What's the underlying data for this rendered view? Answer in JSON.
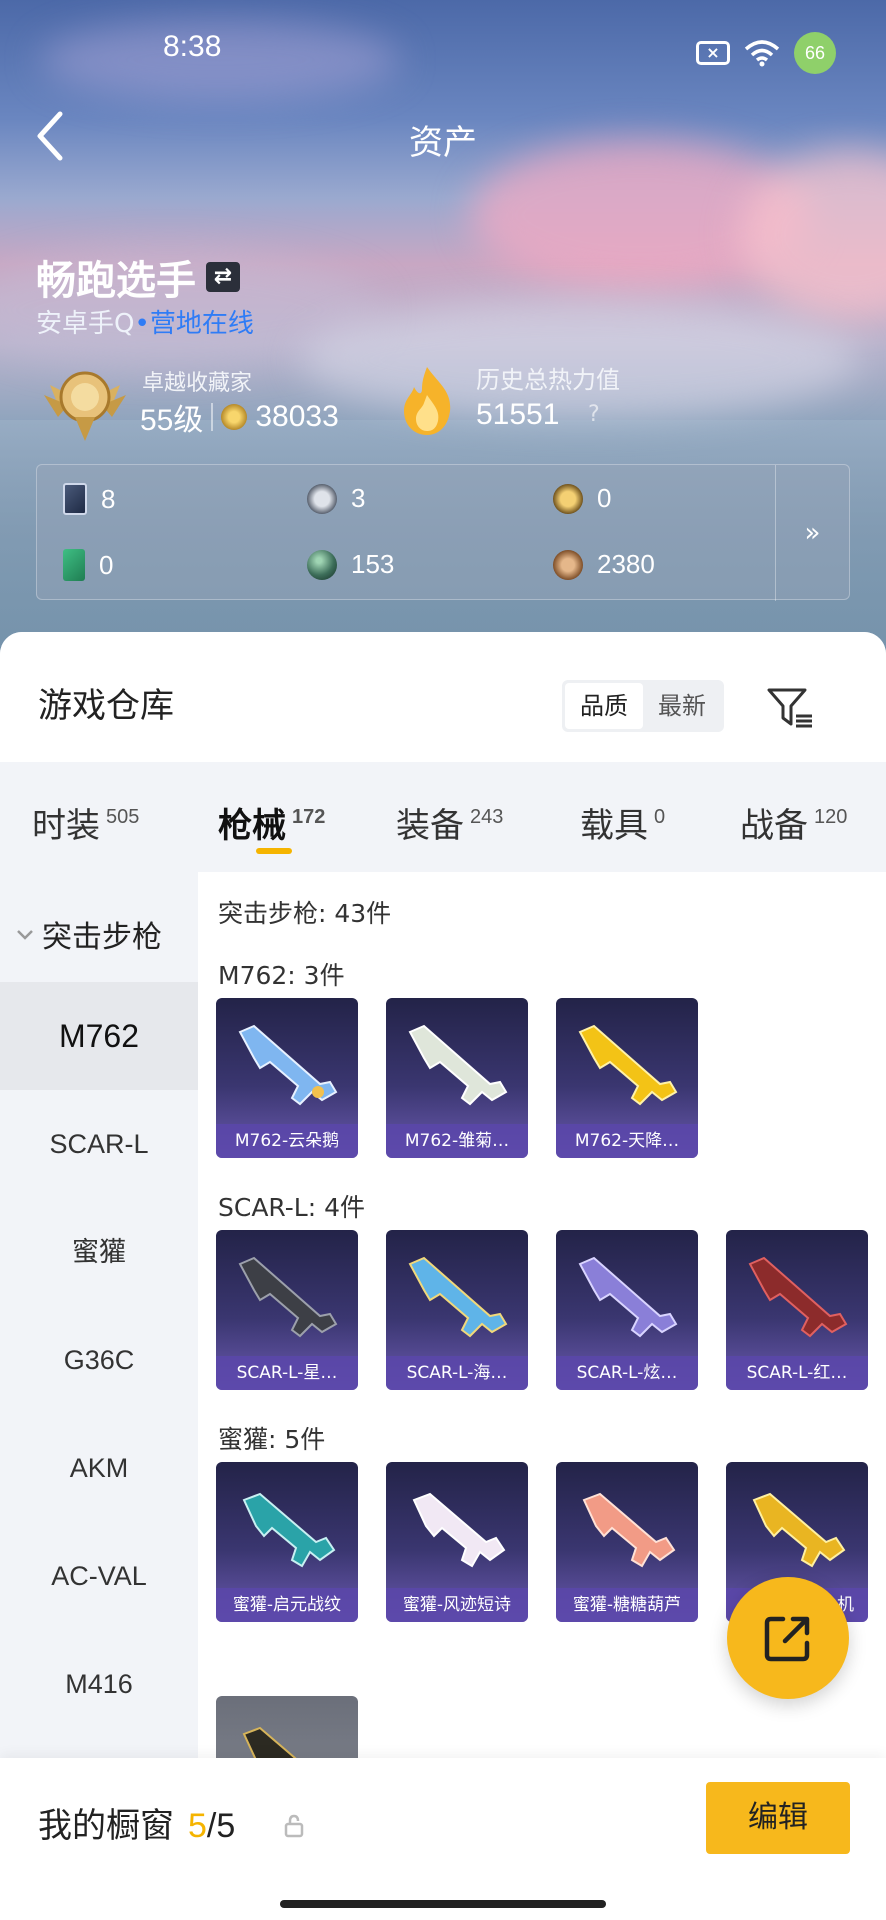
{
  "status": {
    "time": "8:38",
    "battery": "66"
  },
  "header": {
    "title": "资产"
  },
  "profile": {
    "name": "畅跑选手",
    "platform": "安卓手Q",
    "online": "营地在线",
    "rank_title": "卓越收藏家",
    "rank_level": "55级",
    "coins": "38033",
    "heat_title": "历史总热力值",
    "heat_value": "51551",
    "help": "?"
  },
  "stats": [
    {
      "icon": "card-icon",
      "value": "8"
    },
    {
      "icon": "s-coin-icon",
      "value": "3"
    },
    {
      "icon": "a-coin-icon",
      "value": "0"
    },
    {
      "icon": "ticket-icon",
      "value": "0"
    },
    {
      "icon": "orb-icon",
      "value": "153"
    },
    {
      "icon": "bronze-coin-icon",
      "value": "2380"
    }
  ],
  "stats_more": "»",
  "warehouse": {
    "title": "游戏仓库",
    "sort_options": [
      "品质",
      "最新"
    ],
    "sort_selected": "品质"
  },
  "tabs": [
    {
      "label": "时装",
      "count": "505"
    },
    {
      "label": "枪械",
      "count": "172"
    },
    {
      "label": "装备",
      "count": "243"
    },
    {
      "label": "载具",
      "count": "0"
    },
    {
      "label": "战备",
      "count": "120"
    }
  ],
  "sidebar": {
    "category": "突击步枪",
    "items": [
      "M762",
      "SCAR-L",
      "蜜獾",
      "G36C",
      "AKM",
      "AC-VAL",
      "M416"
    ]
  },
  "sections": {
    "total": "突击步枪: 43件",
    "m762": {
      "label": "M762: 3件",
      "items": [
        "M762-云朵鹅",
        "M762-雏菊…",
        "M762-天降…"
      ]
    },
    "scar": {
      "label": "SCAR-L: 4件",
      "items": [
        "SCAR-L-星…",
        "SCAR-L-海…",
        "SCAR-L-炫…",
        "SCAR-L-红…"
      ]
    },
    "honey": {
      "label": "蜜獾: 5件",
      "items": [
        "蜜獾-启元战纹",
        "蜜獾-风迹短诗",
        "蜜獾-糖糖葫芦",
        "机"
      ]
    }
  },
  "colors": {
    "accent": "#f7b81c",
    "online_blue": "#2f7cf6"
  },
  "bottom": {
    "label": "我的橱窗",
    "count_current": "5",
    "count_total": "/5",
    "edit": "编辑"
  }
}
